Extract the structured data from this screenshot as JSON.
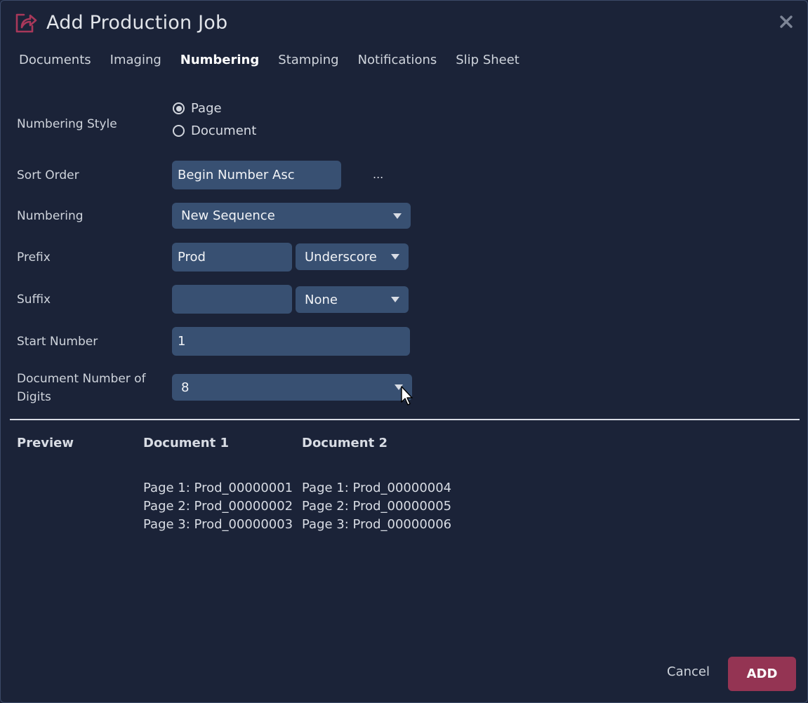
{
  "header": {
    "title": "Add Production Job",
    "icon": "share-export-icon",
    "close_icon": "close-icon"
  },
  "tabs": [
    {
      "label": "Documents",
      "active": false
    },
    {
      "label": "Imaging",
      "active": false
    },
    {
      "label": "Numbering",
      "active": true
    },
    {
      "label": "Stamping",
      "active": false
    },
    {
      "label": "Notifications",
      "active": false
    },
    {
      "label": "Slip Sheet",
      "active": false
    }
  ],
  "form": {
    "numbering_style": {
      "label": "Numbering Style",
      "options": [
        {
          "label": "Page",
          "checked": true
        },
        {
          "label": "Document",
          "checked": false
        }
      ]
    },
    "sort_order": {
      "label": "Sort Order",
      "value": "Begin Number Asc",
      "more_label": "..."
    },
    "numbering": {
      "label": "Numbering",
      "value": "New Sequence"
    },
    "prefix": {
      "label": "Prefix",
      "value": "Prod",
      "separator": "Underscore"
    },
    "suffix": {
      "label": "Suffix",
      "value": "",
      "separator": "None"
    },
    "start_number": {
      "label": "Start Number",
      "value": "1"
    },
    "digits": {
      "label": "Document Number of Digits",
      "value": "8"
    }
  },
  "preview": {
    "label": "Preview",
    "documents": [
      {
        "title": "Document 1",
        "pages": [
          "Page 1: Prod_00000001",
          "Page 2: Prod_00000002",
          "Page 3: Prod_00000003"
        ]
      },
      {
        "title": "Document 2",
        "pages": [
          "Page 1: Prod_00000004",
          "Page 2: Prod_00000005",
          "Page 3: Prod_00000006"
        ]
      }
    ]
  },
  "footer": {
    "cancel_label": "Cancel",
    "add_label": "ADD"
  },
  "colors": {
    "background": "#1b2338",
    "field": "#385072",
    "accent": "#943453"
  }
}
